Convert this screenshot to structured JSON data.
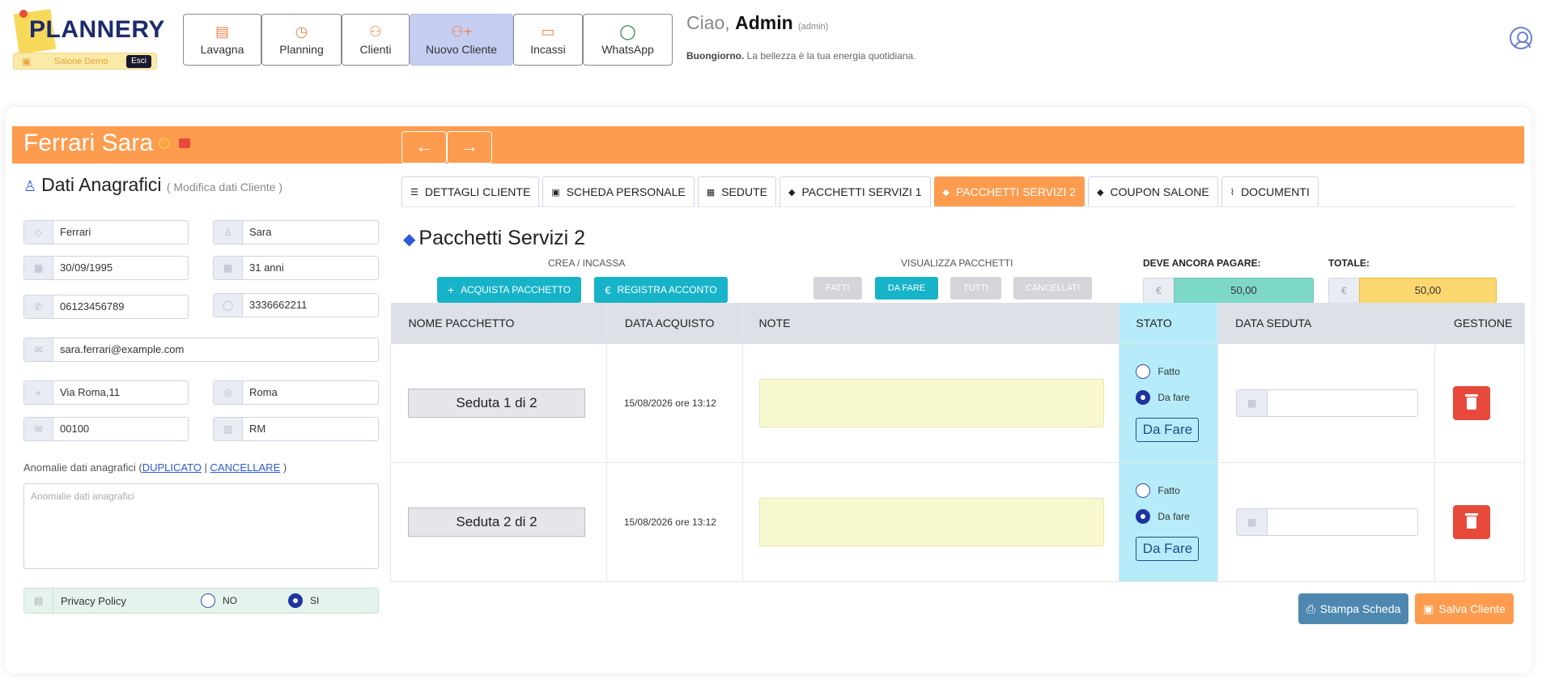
{
  "brand": {
    "logo": "PLANNERY",
    "salon_name": "Salone Demo",
    "esci": "Esci"
  },
  "nav": [
    {
      "label": "Lavagna",
      "icon": "board-icon"
    },
    {
      "label": "Planning",
      "icon": "calendar-icon"
    },
    {
      "label": "Clienti",
      "icon": "users-icon"
    },
    {
      "label": "Nuovo Cliente",
      "icon": "add-user-icon",
      "active": true
    },
    {
      "label": "Incassi",
      "icon": "money-icon"
    },
    {
      "label": "WhatsApp",
      "icon": "whatsapp-icon"
    }
  ],
  "greeting": {
    "ciao": "Ciao,",
    "user": "Admin",
    "role": "(admin)",
    "buongiorno": "Buongiorno.",
    "message": "La bellezza è la tua energia quotidiana."
  },
  "client": {
    "name": "Ferrari Sara"
  },
  "anagrafica": {
    "title": "Dati Anagrafici",
    "subtitle": "( Modifica dati Cliente )",
    "cognome": "Ferrari",
    "nome": "Sara",
    "data_nascita": "30/09/1995",
    "eta": "31 anni",
    "telefono": "06123456789",
    "cellulare": "3336662211",
    "email": "sara.ferrari@example.com",
    "indirizzo": "Via Roma,11",
    "citta": "Roma",
    "cap": "00100",
    "provincia": "RM",
    "anomalie_label": "Anomalie dati anagrafici (",
    "duplicato": "DUPLICATO",
    "sep": "|",
    "cancellare": "CANCELLARE",
    "close": ")",
    "anomalie_placeholder": "Anomalie dati anagrafici",
    "privacy_label": "Privacy Policy",
    "privacy_no": "NO",
    "privacy_si": "SI",
    "privacy_value": "SI"
  },
  "tabs": [
    {
      "label": "DETTAGLI CLIENTE"
    },
    {
      "label": "SCHEDA PERSONALE"
    },
    {
      "label": "SEDUTE"
    },
    {
      "label": "PACCHETTI SERVIZI 1"
    },
    {
      "label": "PACCHETTI SERVIZI 2",
      "active": true
    },
    {
      "label": "COUPON SALONE"
    },
    {
      "label": "DOCUMENTI"
    }
  ],
  "packages": {
    "title": "Pacchetti Servizi 2",
    "crea_label": "CREA / INCASSA",
    "acquista": "ACQUISTA PACCHETTO",
    "acconto": "REGISTRA ACCONTO",
    "visualizza_label": "VISUALIZZA PACCHETTI",
    "filters": [
      "FATTI",
      "DA FARE",
      "TUTTI",
      "CANCELLATI"
    ],
    "active_filter": "DA FARE",
    "deve_label": "DEVE ANCORA PAGARE:",
    "deve_value": "50,00",
    "totale_label": "TOTALE:",
    "totale_value": "50,00",
    "currency": "€",
    "columns": [
      "NOME PACCHETTO",
      "DATA ACQUISTO",
      "NOTE",
      "STATO",
      "DATA SEDUTA",
      "GESTIONE"
    ],
    "rows": [
      {
        "nome": "Seduta 1 di 2",
        "data": "15/08/2026 ore 13:12",
        "note": "",
        "fatto": "Fatto",
        "dafare": "Da fare",
        "stato": "Da Fare",
        "data_seduta": ""
      },
      {
        "nome": "Seduta 2 di 2",
        "data": "15/08/2026 ore 13:12",
        "note": "",
        "fatto": "Fatto",
        "dafare": "Da fare",
        "stato": "Da Fare",
        "data_seduta": ""
      }
    ]
  },
  "actions": {
    "stampa": "Stampa Scheda",
    "salva": "Salva Cliente"
  },
  "colors": {
    "orange": "#fd9c4e",
    "teal": "#17b3c9",
    "stato_bg": "#b6ecf9",
    "deve_bg": "#7ed8c8",
    "totale_bg": "#fcd770"
  }
}
